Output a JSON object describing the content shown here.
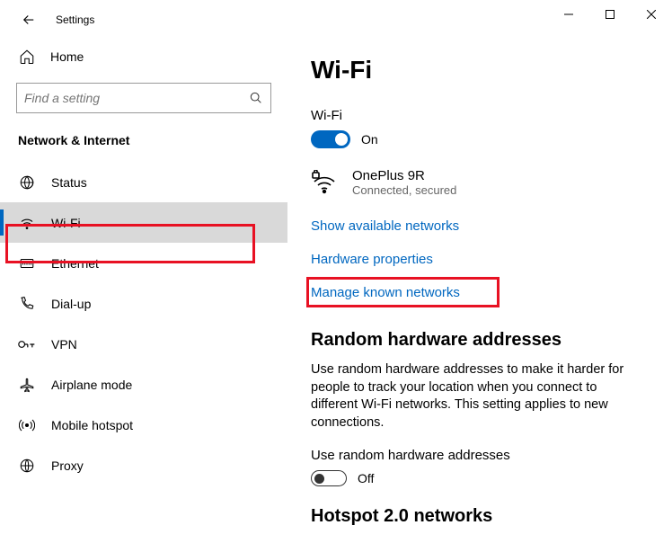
{
  "title": "Settings",
  "home_label": "Home",
  "search_placeholder": "Find a setting",
  "category_title": "Network & Internet",
  "nav": [
    {
      "label": "Status"
    },
    {
      "label": "Wi-Fi"
    },
    {
      "label": "Ethernet"
    },
    {
      "label": "Dial-up"
    },
    {
      "label": "VPN"
    },
    {
      "label": "Airplane mode"
    },
    {
      "label": "Mobile hotspot"
    },
    {
      "label": "Proxy"
    }
  ],
  "page_heading": "Wi-Fi",
  "wifi_toggle_label": "Wi-Fi",
  "wifi_toggle_state": "On",
  "network_name": "OnePlus 9R",
  "network_status": "Connected, secured",
  "links": {
    "available": "Show available networks",
    "properties": "Hardware properties",
    "manage": "Manage known networks"
  },
  "random_heading": "Random hardware addresses",
  "random_body": "Use random hardware addresses to make it harder for people to track your location when you connect to different Wi-Fi networks. This setting applies to new connections.",
  "random_toggle_label": "Use random hardware addresses",
  "random_toggle_state": "Off",
  "hotspot_heading": "Hotspot 2.0 networks"
}
